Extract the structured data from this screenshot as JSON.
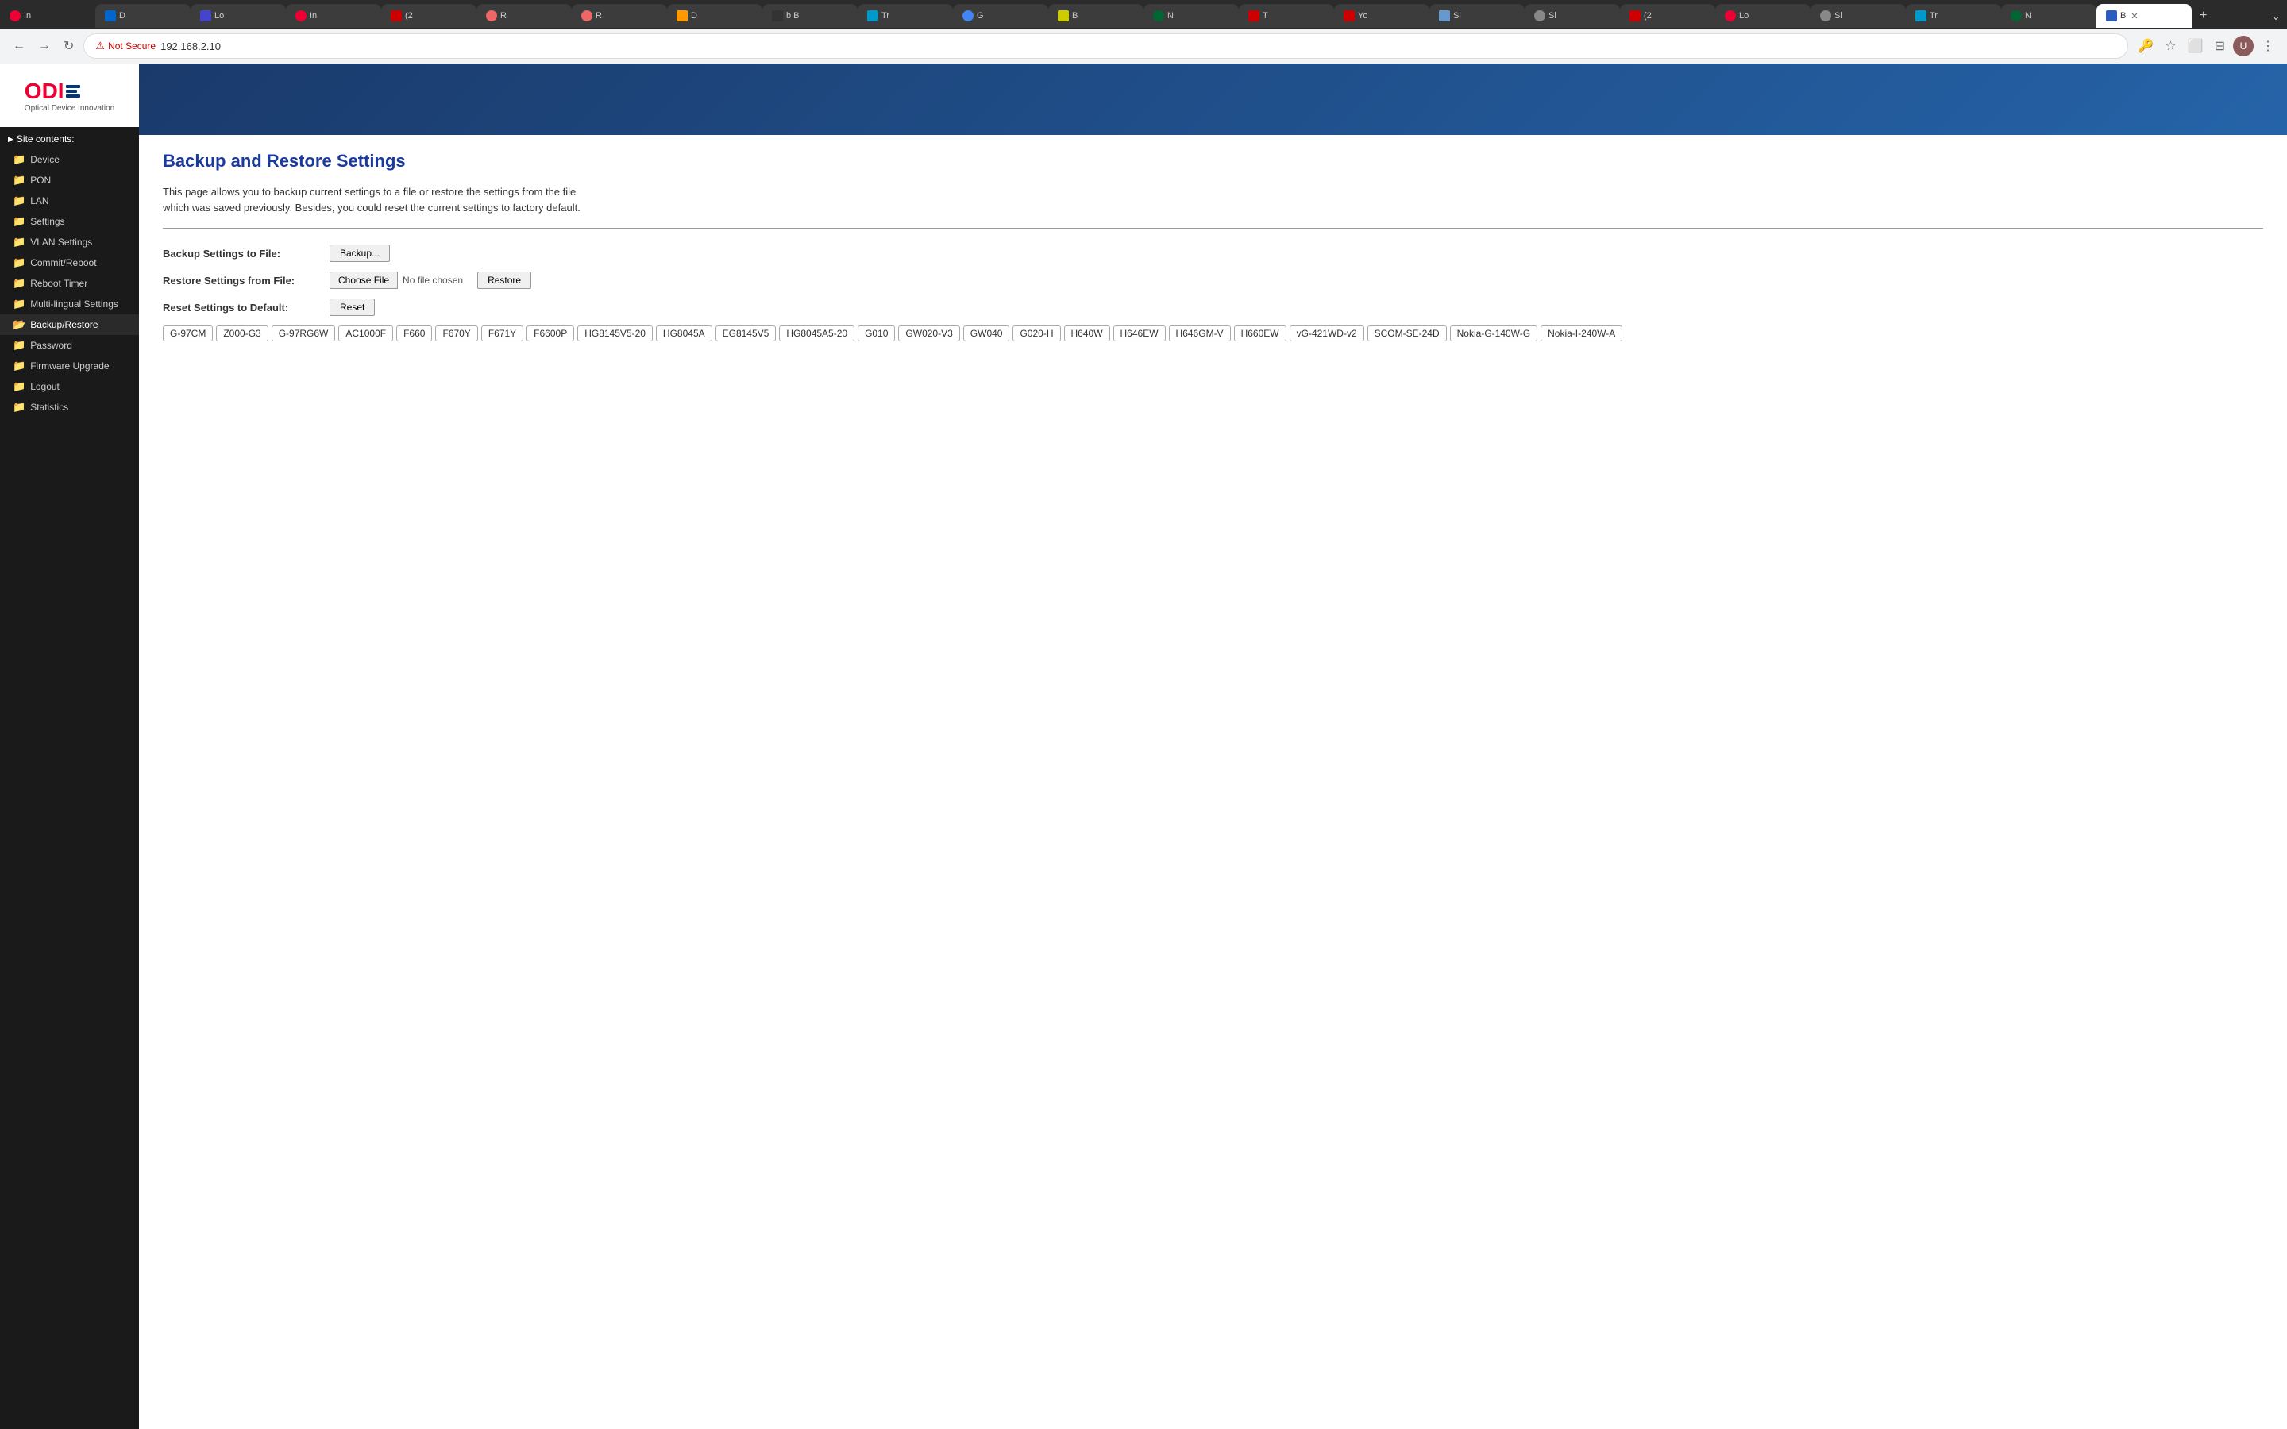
{
  "browser": {
    "tabs": [
      {
        "label": "In",
        "active": false
      },
      {
        "label": "D",
        "active": false
      },
      {
        "label": "Lo",
        "active": false
      },
      {
        "label": "In",
        "active": false
      },
      {
        "label": "(2",
        "active": false
      },
      {
        "label": "R",
        "active": false
      },
      {
        "label": "R",
        "active": false
      },
      {
        "label": "D",
        "active": false
      },
      {
        "label": "b B",
        "active": false
      },
      {
        "label": "Tr",
        "active": false
      },
      {
        "label": "G",
        "active": false
      },
      {
        "label": "B",
        "active": false
      },
      {
        "label": "N",
        "active": false
      },
      {
        "label": "T",
        "active": false
      },
      {
        "label": "Yo",
        "active": false
      },
      {
        "label": "Si",
        "active": false
      },
      {
        "label": "Si",
        "active": false
      },
      {
        "label": "(2",
        "active": false
      },
      {
        "label": "Lo",
        "active": false
      },
      {
        "label": "Si",
        "active": false
      },
      {
        "label": "Tr",
        "active": false
      },
      {
        "label": "N",
        "active": false
      },
      {
        "label": "B",
        "active": true
      }
    ],
    "not_secure_label": "Not Secure",
    "url": "192.168.2.10"
  },
  "sidebar": {
    "site_contents_label": "Site contents:",
    "items": [
      {
        "label": "Device",
        "icon": "folder"
      },
      {
        "label": "PON",
        "icon": "folder"
      },
      {
        "label": "LAN",
        "icon": "folder"
      },
      {
        "label": "Settings",
        "icon": "folder"
      },
      {
        "label": "VLAN Settings",
        "icon": "folder"
      },
      {
        "label": "Commit/Reboot",
        "icon": "folder"
      },
      {
        "label": "Reboot Timer",
        "icon": "folder"
      },
      {
        "label": "Multi-lingual Settings",
        "icon": "folder"
      },
      {
        "label": "Backup/Restore",
        "icon": "folder",
        "active": true
      },
      {
        "label": "Password",
        "icon": "folder"
      },
      {
        "label": "Firmware Upgrade",
        "icon": "folder"
      },
      {
        "label": "Logout",
        "icon": "folder"
      },
      {
        "label": "Statistics",
        "icon": "folder"
      }
    ]
  },
  "main": {
    "page_title": "Backup and Restore Settings",
    "description_line1": "This page allows you to backup current settings to a file or restore the settings from the file",
    "description_line2": "which was saved previously. Besides, you could reset the current settings to factory default.",
    "backup_label": "Backup Settings to File:",
    "backup_btn": "Backup...",
    "restore_label": "Restore Settings from File:",
    "choose_file_btn": "Choose File",
    "no_file_text": "No file chosen",
    "restore_btn": "Restore",
    "reset_label": "Reset Settings to Default:",
    "reset_btn": "Reset",
    "model_tags": [
      "G-97CM",
      "Z000-G3",
      "G-97RG6W",
      "AC1000F",
      "F660",
      "F670Y",
      "F671Y",
      "F6600P",
      "HG8145V5-20",
      "HG8045A",
      "EG8145V5",
      "HG8045A5-20",
      "G010",
      "GW020-V3",
      "GW040",
      "G020-H",
      "H640W",
      "H646EW",
      "H646GM-V",
      "H660EW",
      "vG-421WD-v2",
      "SCOM-SE-24D",
      "Nokia-G-140W-G",
      "Nokia-I-240W-A"
    ]
  }
}
